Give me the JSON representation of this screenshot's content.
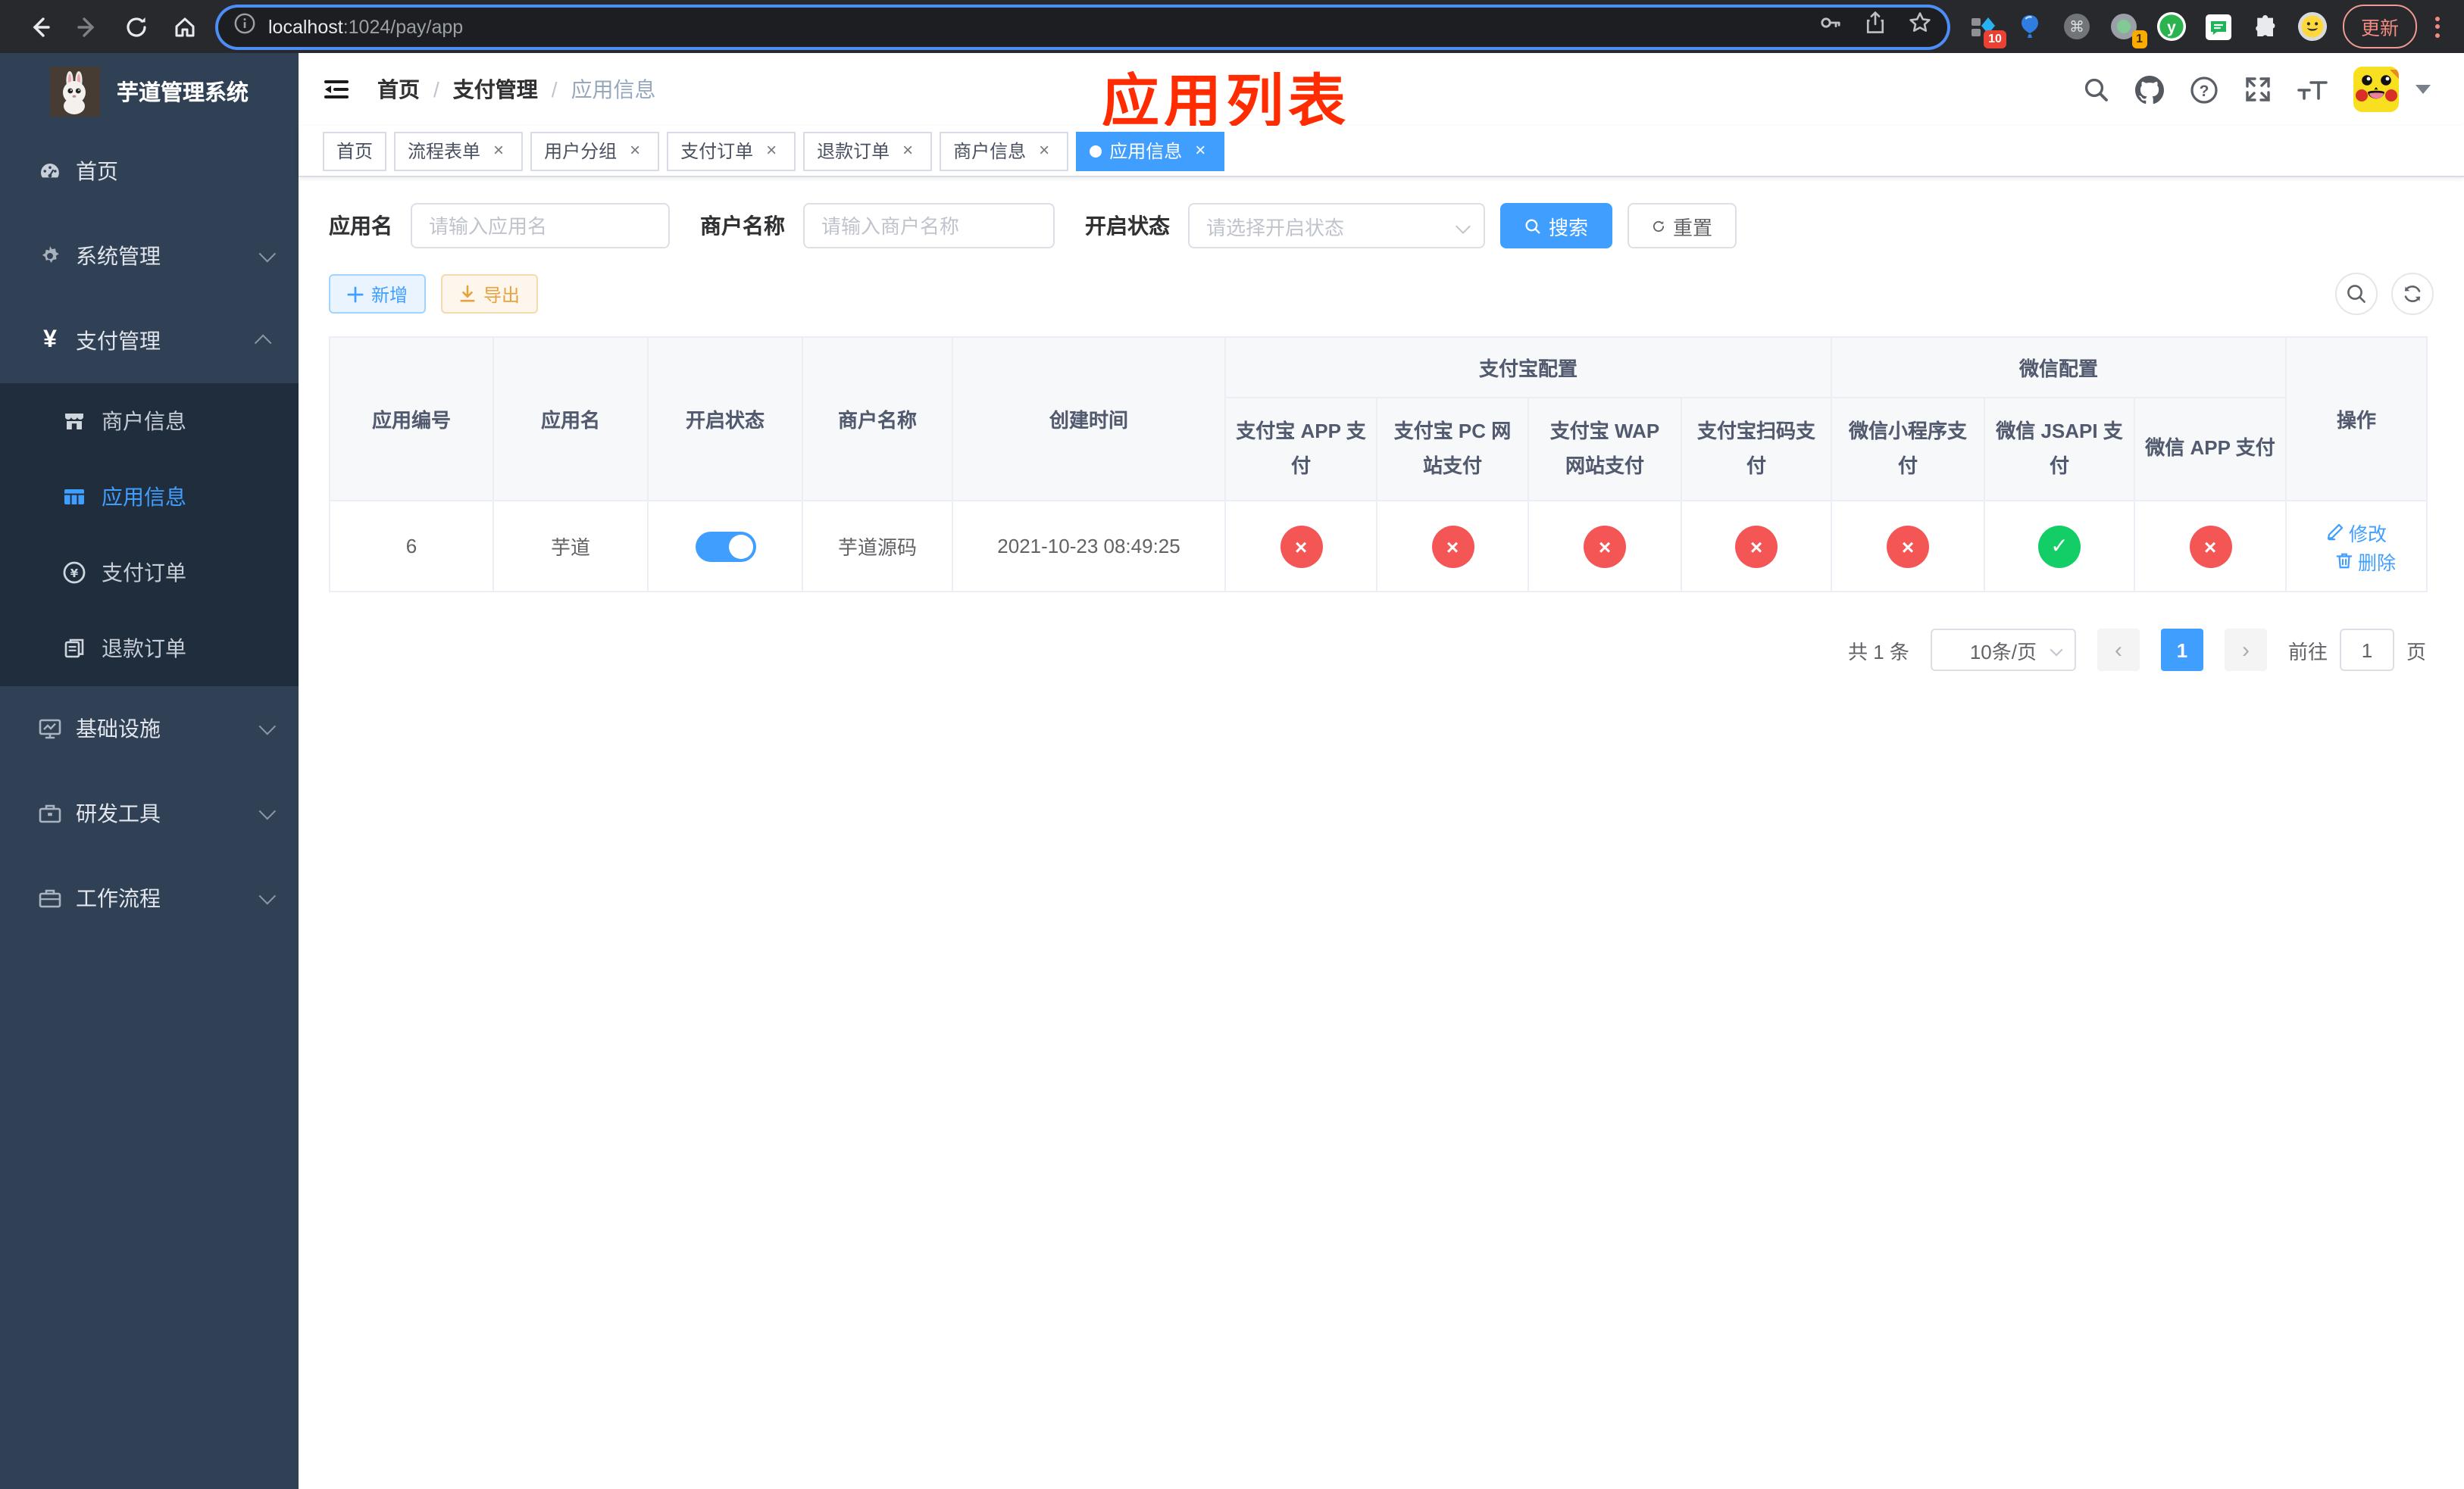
{
  "browser": {
    "url_host": "localhost",
    "url_rest": ":1024/pay/app",
    "update_label": "更新",
    "ext_badges": {
      "collections": "10",
      "recorder": "1"
    }
  },
  "sidebar": {
    "title": "芋道管理系统",
    "items": [
      {
        "label": "首页"
      },
      {
        "label": "系统管理"
      },
      {
        "label": "支付管理"
      },
      {
        "label": "基础设施"
      },
      {
        "label": "研发工具"
      },
      {
        "label": "工作流程"
      }
    ],
    "pay_children": [
      {
        "label": "商户信息"
      },
      {
        "label": "应用信息"
      },
      {
        "label": "支付订单"
      },
      {
        "label": "退款订单"
      }
    ]
  },
  "header": {
    "breadcrumb": [
      "首页",
      "支付管理",
      "应用信息"
    ],
    "separator": "/",
    "annotation": "应用列表"
  },
  "tabs": [
    {
      "label": "首页"
    },
    {
      "label": "流程表单"
    },
    {
      "label": "用户分组"
    },
    {
      "label": "支付订单"
    },
    {
      "label": "退款订单"
    },
    {
      "label": "商户信息"
    },
    {
      "label": "应用信息"
    }
  ],
  "filters": {
    "app_name_label": "应用名",
    "app_name_placeholder": "请输入应用名",
    "merchant_label": "商户名称",
    "merchant_placeholder": "请输入商户名称",
    "status_label": "开启状态",
    "status_placeholder": "请选择开启状态",
    "search_label": "搜索",
    "reset_label": "重置"
  },
  "toolbar": {
    "add_label": "新增",
    "export_label": "导出"
  },
  "table": {
    "columns_left": [
      "应用编号",
      "应用名",
      "开启状态",
      "商户名称",
      "创建时间"
    ],
    "group_alipay": "支付宝配置",
    "group_wechat": "微信配置",
    "columns_alipay": [
      "支付宝 APP 支付",
      "支付宝 PC 网站支付",
      "支付宝 WAP 网站支付",
      "支付宝扫码支付"
    ],
    "columns_wechat": [
      "微信小程序支付",
      "微信 JSAPI 支付",
      "微信 APP 支付"
    ],
    "column_op": "操作",
    "rows": [
      {
        "app_id": "6",
        "app_name": "芋道",
        "enabled": true,
        "merchant_name": "芋道源码",
        "create_time": "2021-10-23 08:49:25",
        "pay_statuses": [
          "no",
          "no",
          "no",
          "no",
          "no",
          "yes",
          "no"
        ],
        "edit_label": "修改",
        "delete_label": "删除"
      }
    ]
  },
  "pagination": {
    "total": "共 1 条",
    "page_size": "10条/页",
    "page": "1",
    "goto_label": "前往",
    "goto_value": "1",
    "unit_label": "页"
  },
  "icons": {
    "check": "✓",
    "close_x": "×",
    "prev": "‹",
    "next": "›"
  },
  "colors": {
    "primary": "#409eff",
    "success": "#13ce66",
    "danger": "#f45656",
    "warning": "#e6a23c",
    "sidebar_bg": "#304156",
    "submenu_bg": "#1f2d3d",
    "annotation_red": "#fe2c00"
  }
}
